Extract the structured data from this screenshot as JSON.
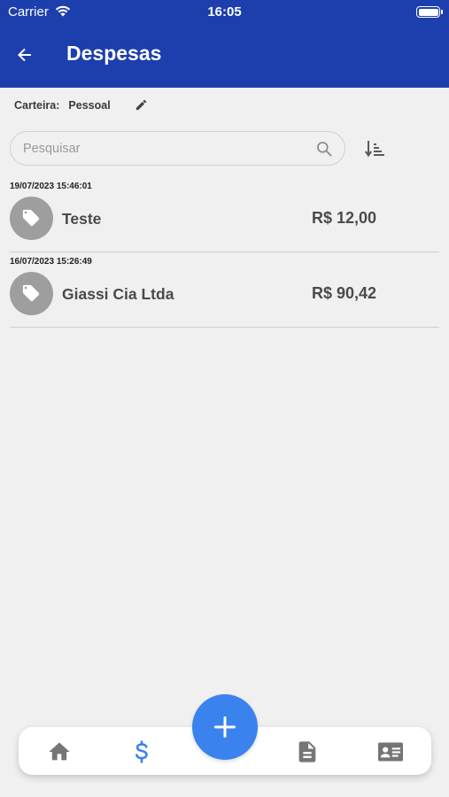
{
  "status_bar": {
    "carrier": "Carrier",
    "time": "16:05"
  },
  "header": {
    "title": "Despesas"
  },
  "wallet": {
    "label": "Carteira:",
    "value": "Pessoal"
  },
  "search": {
    "placeholder": "Pesquisar",
    "value": ""
  },
  "expenses": [
    {
      "date": "19/07/2023 15:46:01",
      "name": "Teste",
      "amount": "R$ 12,00"
    },
    {
      "date": "16/07/2023 15:26:49",
      "name": "Giassi Cia Ltda",
      "amount": "R$ 90,42"
    }
  ],
  "bottom_nav": {
    "items": [
      {
        "icon": "home-icon"
      },
      {
        "icon": "dollar-icon",
        "active": true
      },
      {
        "icon": "document-icon"
      },
      {
        "icon": "contact-card-icon"
      }
    ],
    "fab_icon": "plus-icon"
  },
  "colors": {
    "header": "#1d3fad",
    "accent": "#3a82ed",
    "icon_inactive": "#757575",
    "avatar": "#9e9e9e"
  }
}
